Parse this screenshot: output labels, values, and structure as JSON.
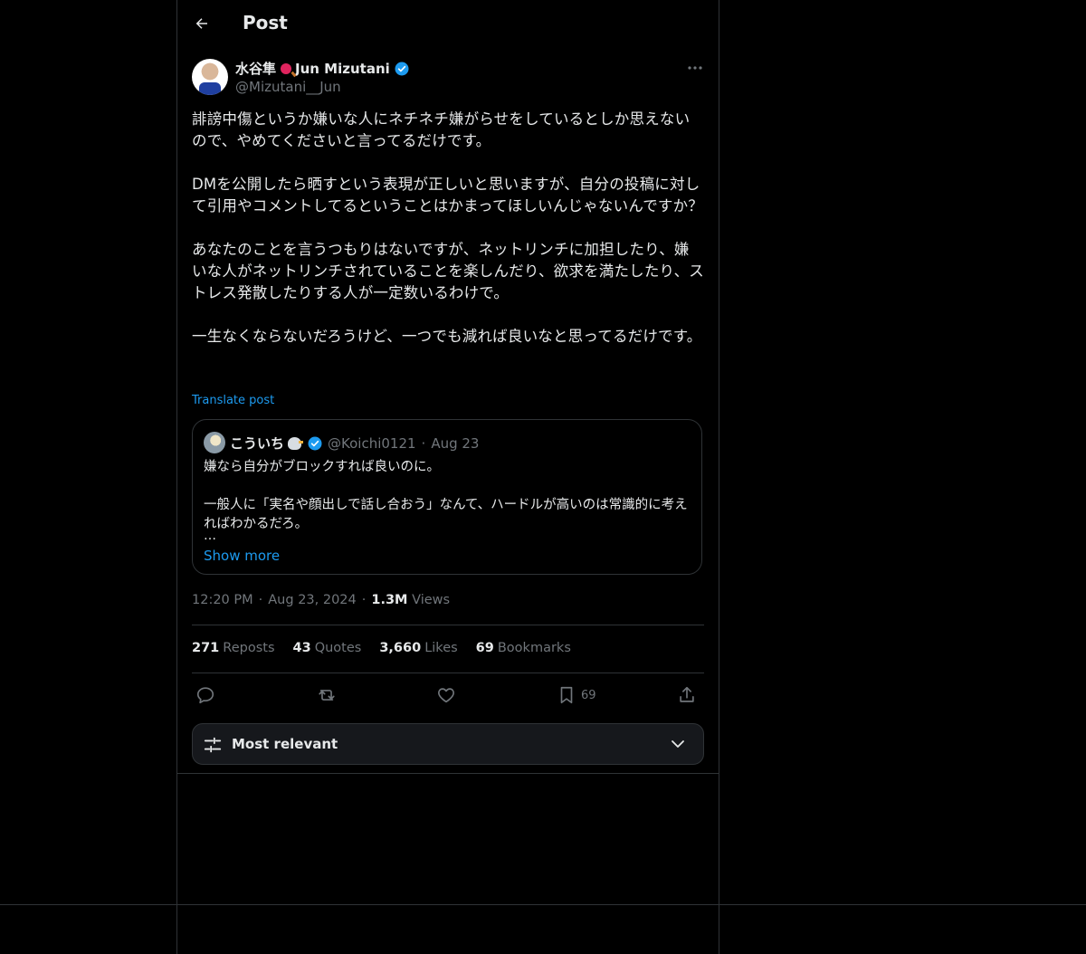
{
  "topbar": {
    "title": "Post"
  },
  "post": {
    "author_name": "水谷隼",
    "author_name_suffix": "Jun Mizutani",
    "author_handle": "@Mizutani__Jun",
    "body": "誹謗中傷というか嫌いな人にネチネチ嫌がらせをしているとしか思えないので、やめてくださいと言ってるだけです。\n\nDMを公開したら晒すという表現が正しいと思いますが、自分の投稿に対して引用やコメントしてるということはかまってほしいんじゃないんですか？\n\nあなたのことを言うつもりはないですが、ネットリンチに加担したり、嫌いな人がネットリンチされていることを楽しんだり、欲求を満たしたり、ストレス発散したりする人が一定数いるわけで。\n\n一生なくならないだろうけど、一つでも減れば良いなと思ってるだけです。",
    "translate_label": "Translate post",
    "time": "12:20 PM",
    "date": "Aug 23, 2024",
    "views_count": "1.3M",
    "views_label": "Views",
    "dot": "·"
  },
  "quote": {
    "name": "こういち",
    "handle": "@Koichi0121",
    "dot": "·",
    "date": "Aug 23",
    "body": "嫌なら自分がブロックすれば良いのに。\n\n一般人に「実名や顔出しで話し合おう」なんて、ハードルが高いのは常識的に考えればわかるだろ。",
    "ellipsis": "…",
    "show_more": "Show more"
  },
  "stats": {
    "reposts_count": "271",
    "reposts_label": "Reposts",
    "quotes_count": "43",
    "quotes_label": "Quotes",
    "likes_count": "3,660",
    "likes_label": "Likes",
    "bookmarks_count": "69",
    "bookmarks_label": "Bookmarks"
  },
  "actions": {
    "bookmark_count": "69"
  },
  "sort": {
    "label": "Most relevant"
  },
  "colors": {
    "accent": "#1d9bf0",
    "muted": "#71767b",
    "border": "#2f3336",
    "text": "#e7e9ea",
    "background": "#000000"
  },
  "icons": [
    "back-arrow-icon",
    "verified-badge-icon",
    "more-icon",
    "reply-icon",
    "repost-icon",
    "like-icon",
    "bookmark-icon",
    "share-icon",
    "sliders-icon",
    "chevron-down-icon"
  ]
}
